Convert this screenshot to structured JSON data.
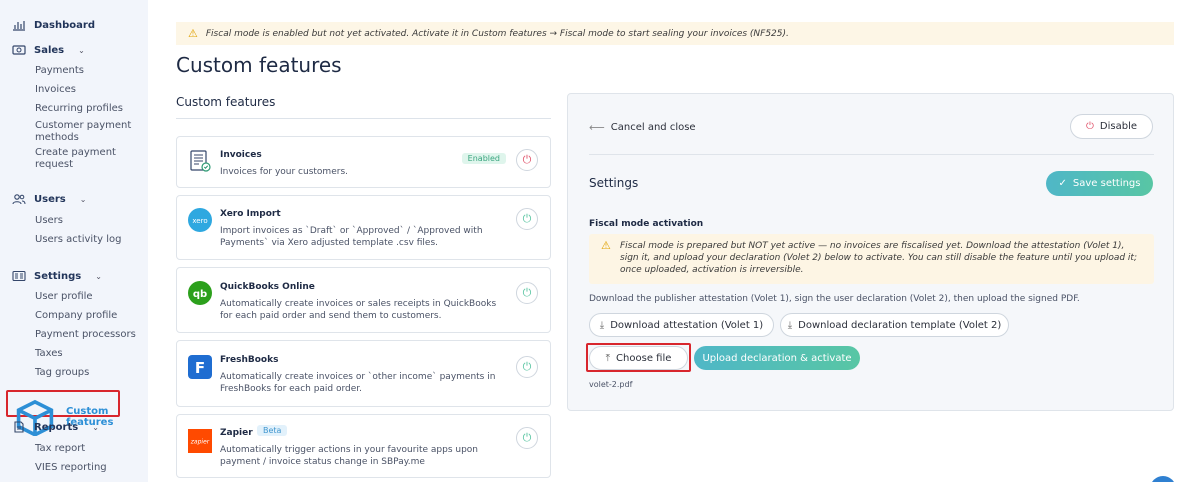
{
  "sidebar": {
    "dashboard": "Dashboard",
    "sales": "Sales",
    "sales_items": [
      "Payments",
      "Invoices",
      "Recurring profiles",
      "Customer payment methods",
      "Create payment request"
    ],
    "users": "Users",
    "users_items": [
      "Users",
      "Users activity log"
    ],
    "settings": "Settings",
    "settings_items": [
      "User profile",
      "Company profile",
      "Payment processors",
      "Taxes",
      "Tag groups"
    ],
    "custom_features": "Custom features",
    "reports": "Reports",
    "reports_items": [
      "Tax report",
      "VIES reporting"
    ]
  },
  "banner": {
    "text": "Fiscal mode is enabled but not yet activated. Activate it in Custom features → Fiscal mode to start sealing your invoices (NF525)."
  },
  "page_title": "Custom features",
  "left_title": "Custom features",
  "features": [
    {
      "name": "Invoices",
      "desc": "Invoices for your customers.",
      "badge": "Enabled"
    },
    {
      "name": "Xero Import",
      "desc": "Import invoices as `Draft` or `Approved` / `Approved with Payments` via Xero adjusted template .csv files."
    },
    {
      "name": "QuickBooks Online",
      "desc": "Automatically create invoices or sales receipts in QuickBooks for each paid order and send them to customers."
    },
    {
      "name": "FreshBooks",
      "desc": "Automatically create invoices or `other income` payments in FreshBooks for each paid order."
    },
    {
      "name": "Zapier",
      "desc": "Automatically trigger actions in your favourite apps upon payment / invoice status change in SBPay.me",
      "badge": "Beta"
    }
  ],
  "panel": {
    "cancel": "Cancel and close",
    "disable": "Disable",
    "settings": "Settings",
    "save": "Save settings",
    "fm_label": "Fiscal mode activation",
    "fm_warning": "Fiscal mode is prepared but NOT yet active — no invoices are fiscalised yet. Download the attestation (Volet 1), sign it, and upload your declaration (Volet 2) below to activate. You can still disable the feature until you upload it; once uploaded, activation is irreversible.",
    "instructions": "Download the publisher attestation (Volet 1), sign the user declaration (Volet 2), then upload the signed PDF.",
    "download_attestation": "Download attestation (Volet 1)",
    "download_declaration": "Download declaration template (Volet 2)",
    "choose_file": "Choose file",
    "upload": "Upload declaration & activate",
    "file_name": "volet-2.pdf"
  },
  "colors": {
    "accent_blue": "#2d8fd6",
    "teal_gradient_start": "#4fb7c7",
    "teal_gradient_end": "#58c6a4",
    "highlight_red": "#d8262d",
    "warning_bg": "#fdf6e6"
  }
}
